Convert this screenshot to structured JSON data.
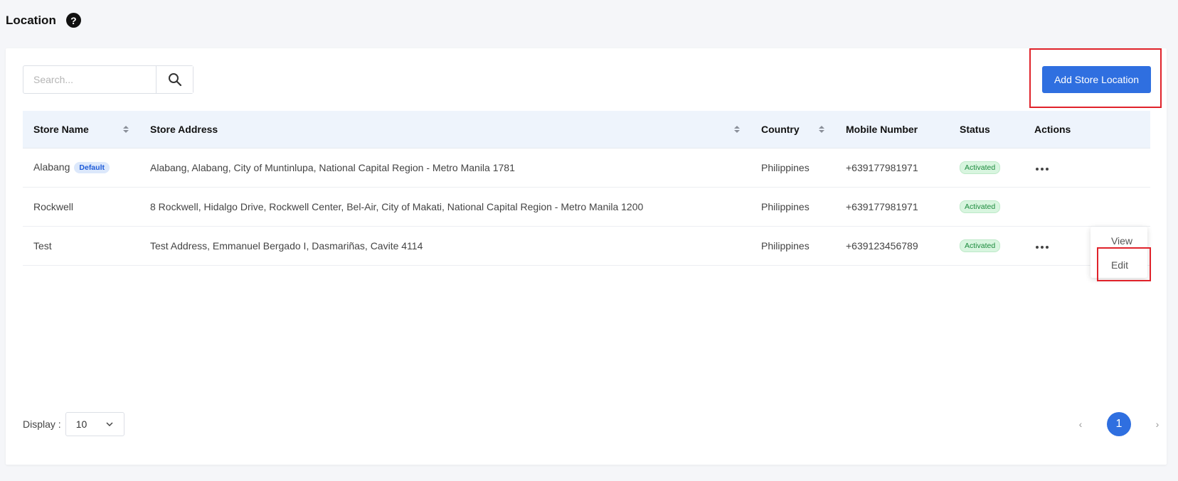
{
  "header": {
    "title": "Location",
    "help_glyph": "?"
  },
  "toolbar": {
    "search_placeholder": "Search...",
    "add_label": "Add Store Location"
  },
  "table": {
    "columns": [
      "Store Name",
      "Store Address",
      "Country",
      "Mobile Number",
      "Status",
      "Actions"
    ],
    "rows": [
      {
        "name": "Alabang",
        "badge": "Default",
        "address": "Alabang, Alabang, City of Muntinlupa, National Capital Region - Metro Manila 1781",
        "country": "Philippines",
        "mobile": "+639177981971",
        "status": "Activated"
      },
      {
        "name": "Rockwell",
        "address": "8 Rockwell, Hidalgo Drive, Rockwell Center, Bel-Air, City of Makati, National Capital Region - Metro Manila 1200",
        "country": "Philippines",
        "mobile": "+639177981971",
        "status": "Activated"
      },
      {
        "name": "Test",
        "address": "Test Address, Emmanuel Bergado I, Dasmariñas, Cavite 4114",
        "country": "Philippines",
        "mobile": "+639123456789",
        "status": "Activated"
      }
    ]
  },
  "actions_menu": {
    "view_label": "View",
    "edit_label": "Edit"
  },
  "footer": {
    "display_label": "Display :",
    "display_value": "10",
    "current_page": "1",
    "prev_glyph": "‹",
    "next_glyph": "›"
  },
  "colors": {
    "accent": "#2f6fe0",
    "highlight": "#e0222a",
    "status_bg": "#d8f5df",
    "default_badge": "#dce8fb"
  }
}
